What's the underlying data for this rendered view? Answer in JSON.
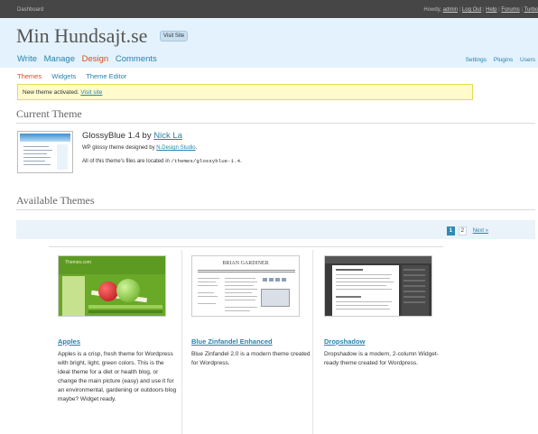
{
  "topbar": {
    "left": "Dashboard",
    "howdy_prefix": "Howdy, ",
    "user": "admin",
    "links": [
      "Log Out",
      "Help",
      "Forums",
      "Turbo"
    ]
  },
  "header": {
    "site_title": "Min Hundsajt.se",
    "visit_button": "Visit Site",
    "menu": [
      {
        "label": "Write",
        "current": false
      },
      {
        "label": "Manage",
        "current": false
      },
      {
        "label": "Design",
        "current": true
      },
      {
        "label": "Comments",
        "current": false
      }
    ],
    "right_menu": [
      "Settings",
      "Plugins",
      "Users"
    ]
  },
  "submenu": [
    {
      "label": "Themes",
      "current": true
    },
    {
      "label": "Widgets",
      "current": false
    },
    {
      "label": "Theme Editor",
      "current": false
    }
  ],
  "notice": {
    "text": "New theme activated.",
    "link": "Visit site"
  },
  "current_theme": {
    "heading": "Current Theme",
    "name": "GlossyBlue 1.4 by ",
    "author": "Nick La",
    "desc_prefix": "WP glossy theme designed by ",
    "desc_link": "N.Design Studio",
    "desc_suffix": ".",
    "files_prefix": "All of this theme's files are located in ",
    "files_path": "/themes/glossyblue-1.4",
    "files_suffix": "."
  },
  "available": {
    "heading": "Available Themes",
    "pages": [
      "1",
      "2"
    ],
    "current_page": "1",
    "next_label": "Next »",
    "themes": [
      {
        "name": "Apples",
        "desc": "Apples is a crisp, fresh theme for Wordpress with bright, light, green colors. This is the ideal theme for a diet or health blog, or change the main picture (easy) and use it for an environmental, gardening or outdoors blog maybe? Widget ready.",
        "shot_title": "Themes.com"
      },
      {
        "name": "Blue Zinfandel Enhanced",
        "desc": "Blue Zinfandel 2.0 is a modern theme created for Wordpress.",
        "shot_title": "BRIAN GARDINER"
      },
      {
        "name": "Dropshadow",
        "desc": "Dropshadow is a modern, 2-column Widget-ready theme created for Wordpress."
      }
    ]
  },
  "colors": {
    "accent": "#2583ad",
    "current": "#d54e21",
    "header_bg": "#e4f2fd",
    "topbar_bg": "#464646",
    "notice_bg": "#fffbcc"
  }
}
